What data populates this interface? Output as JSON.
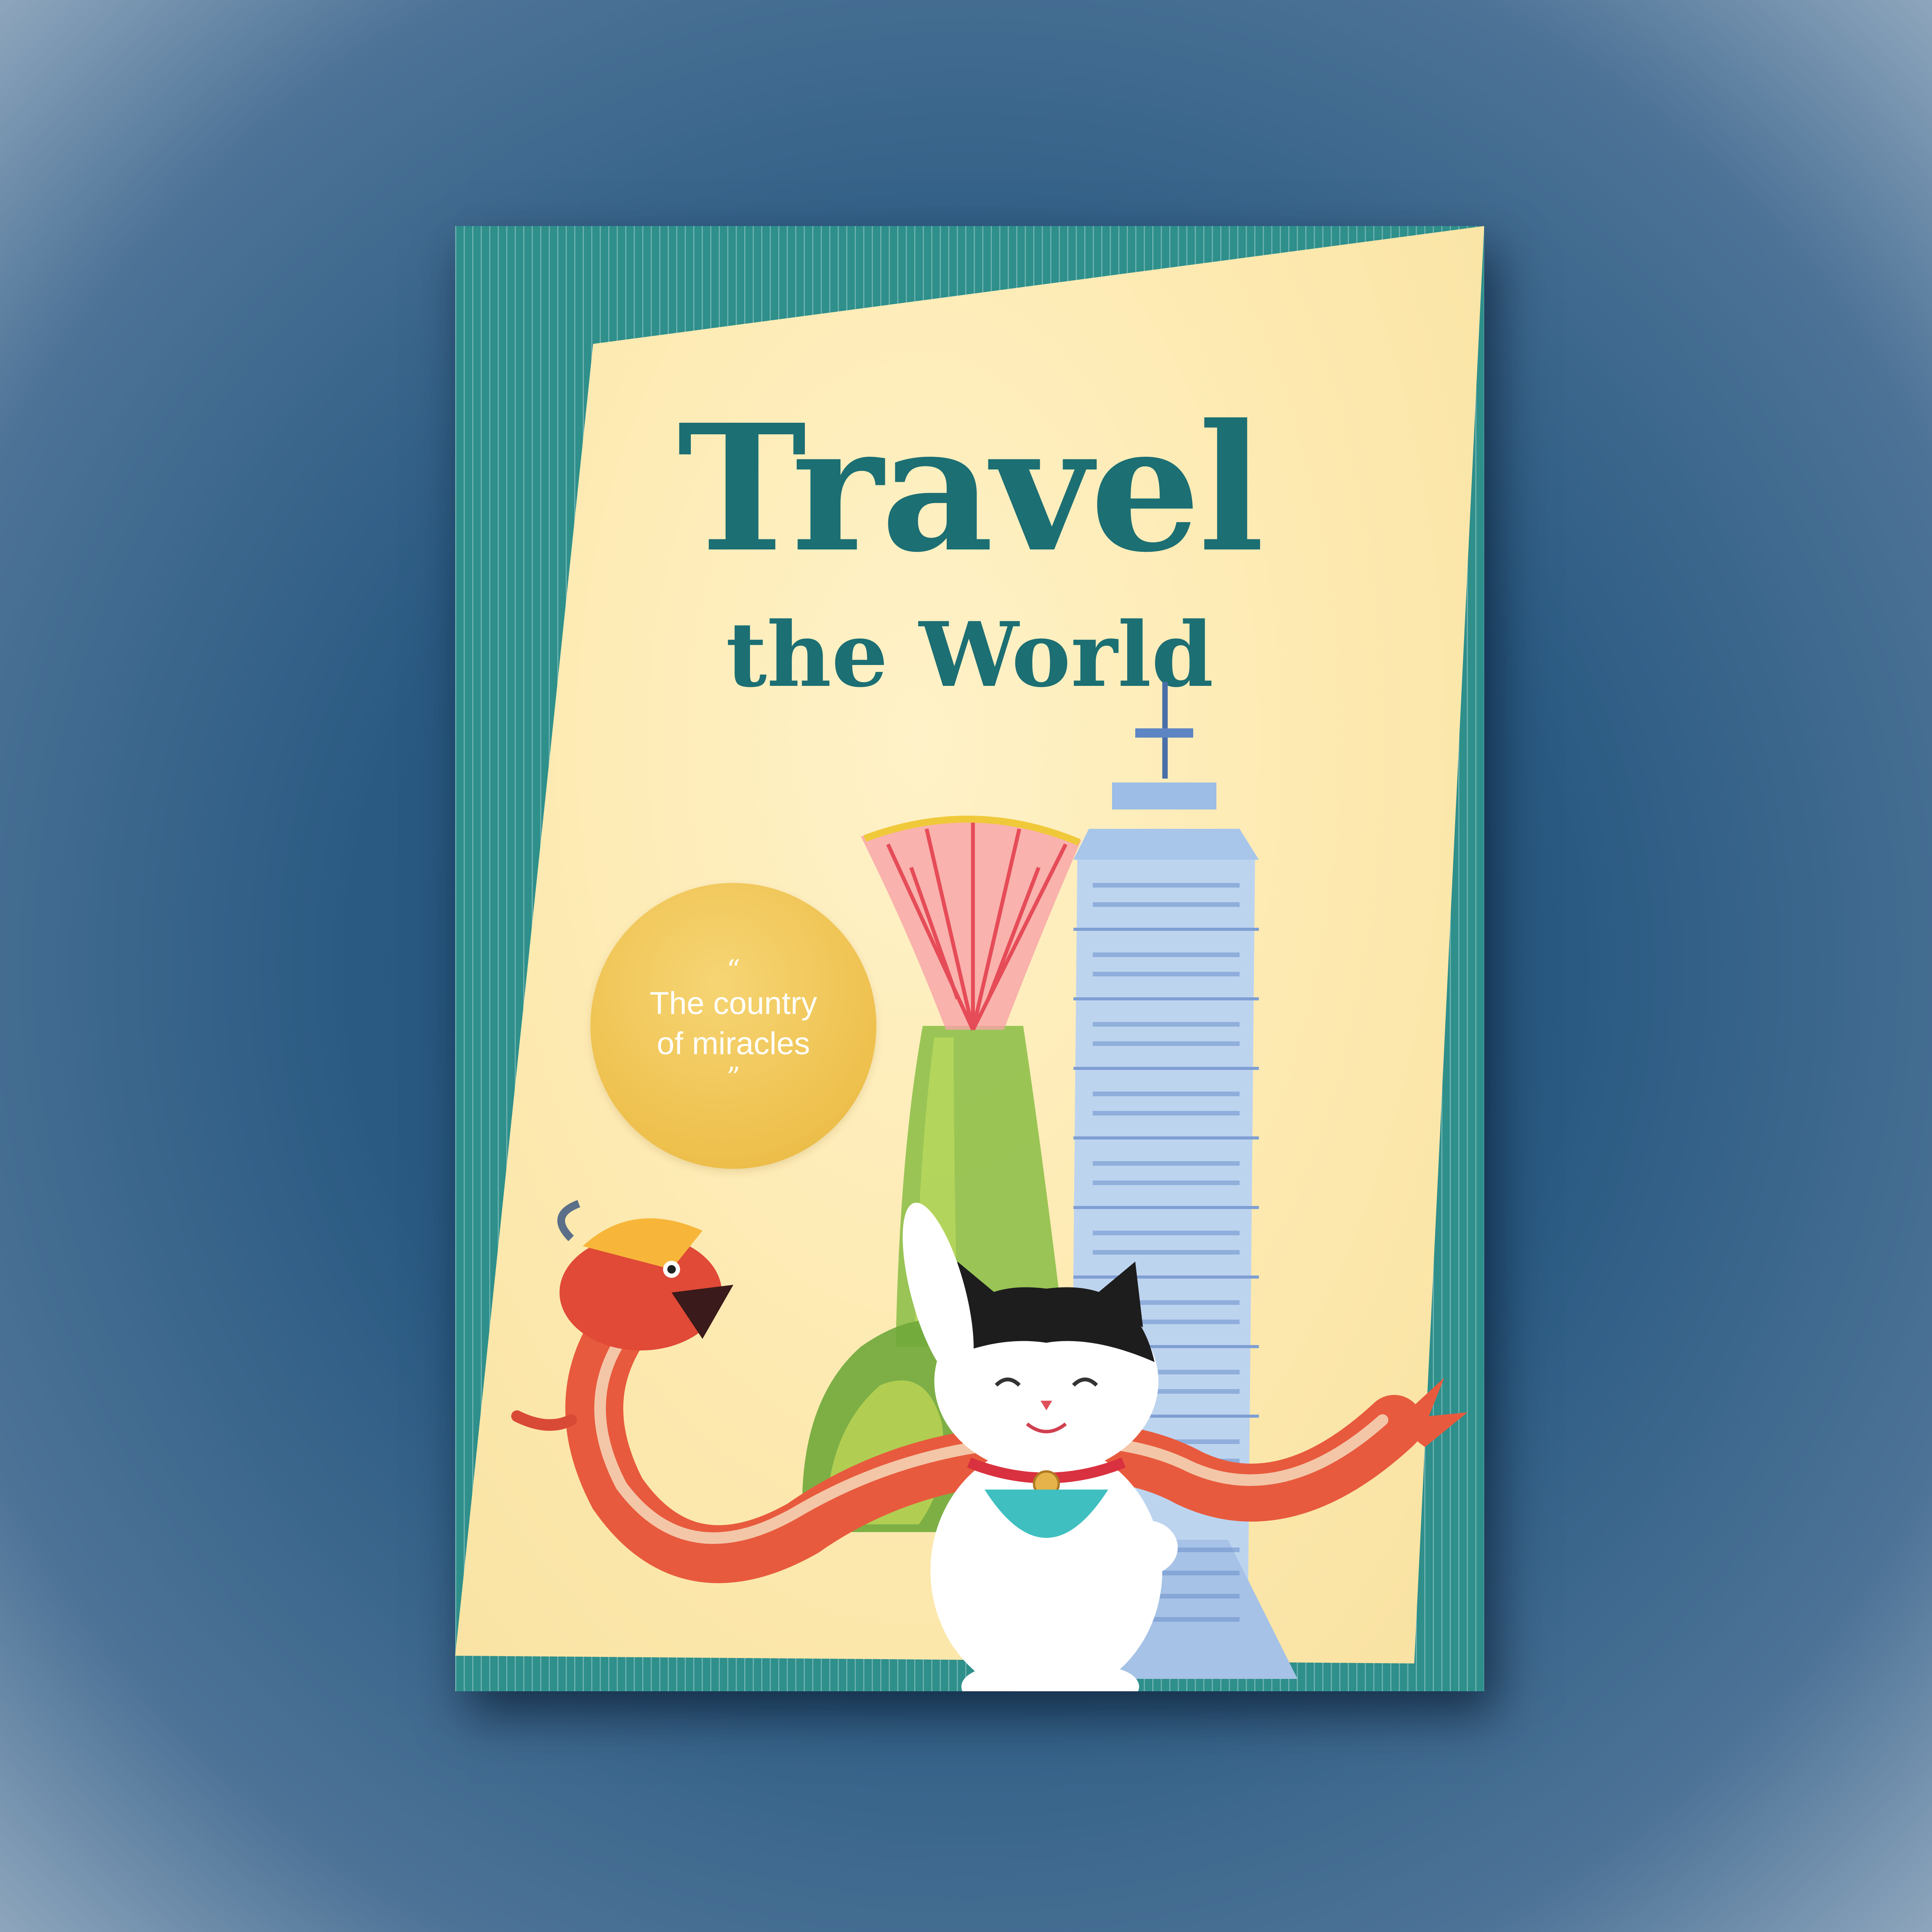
{
  "poster": {
    "title_line1": "Travel",
    "title_line2": "the World",
    "badge": {
      "open_quote": "“",
      "text_line1": "The country",
      "text_line2": "of miracles",
      "close_quote": "”"
    },
    "illustrations": [
      "supertree-grove",
      "taipei-101-tower",
      "chinese-dragon",
      "maneki-neko-cat"
    ]
  },
  "colors": {
    "background": "#2a5a82",
    "poster_border": "#2e8f8b",
    "panel": "#fde9af",
    "title": "#1c6f73",
    "badge": "#eec04d"
  }
}
